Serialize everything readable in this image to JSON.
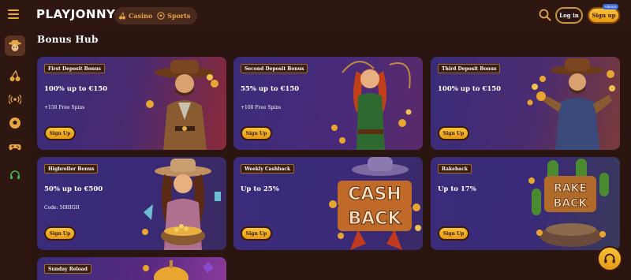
{
  "header": {
    "logo": "PLAYJONNY",
    "categories": [
      {
        "label": "Casino",
        "icon": "cherries-icon"
      },
      {
        "label": "Sports",
        "icon": "soccer-ball-icon"
      }
    ],
    "login_label": "Log in",
    "signup_label": "Sign up",
    "signup_badge": "+bonus"
  },
  "sidebar": {
    "items": [
      {
        "name": "cowboy-mascot-icon",
        "active": true
      },
      {
        "name": "cherries-icon"
      },
      {
        "name": "live-broadcast-icon"
      },
      {
        "name": "soccer-ball-icon"
      },
      {
        "name": "gamepad-icon"
      },
      {
        "name": "headset-icon",
        "color": "#3db84a"
      }
    ]
  },
  "page": {
    "title": "Bonus Hub"
  },
  "cards": [
    {
      "label": "First Deposit Bonus",
      "offer": "100% up to €150",
      "sub": "+150 Free Spins",
      "cta": "Sign Up"
    },
    {
      "label": "Second Deposit Bonus",
      "offer": "55% up to €150",
      "sub": "+100 Free Spins",
      "cta": "Sign Up"
    },
    {
      "label": "Third Deposit Bonus",
      "offer": "100% up to €150",
      "sub": "",
      "cta": "Sign Up"
    },
    {
      "label": "Highroller Bonus",
      "offer": "50% up to €500",
      "sub": "Code: 50HIGH",
      "cta": "Sign Up"
    },
    {
      "label": "Weekly Cashback",
      "offer": "Up to 25%",
      "sub": "",
      "cta": "Sign Up",
      "art_text": [
        "CASH",
        "BACK"
      ]
    },
    {
      "label": "Rakeback",
      "offer": "Up to 17%",
      "sub": "",
      "cta": "Sign Up",
      "art_text": [
        "RAKE",
        "BACK"
      ]
    },
    {
      "label": "Sunday Reload"
    }
  ],
  "colors": {
    "background": "#2a1510",
    "accent": "#f5b731",
    "card_purple": "#3b2a78",
    "card_red": "#8a2a2a"
  }
}
